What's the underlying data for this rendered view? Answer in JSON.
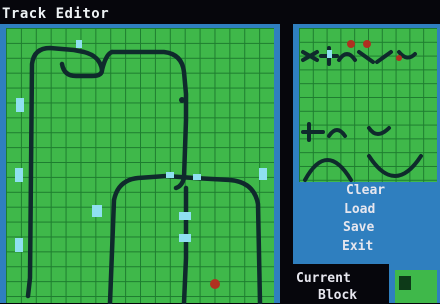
{
  "window": {
    "title": "Track Editor"
  },
  "menu": {
    "items": [
      {
        "id": "clear",
        "label": "Clear"
      },
      {
        "id": "load",
        "label": "Load"
      },
      {
        "id": "save",
        "label": "Save"
      },
      {
        "id": "exit",
        "label": "Exit"
      }
    ]
  },
  "current_block": {
    "label_line1": "Current",
    "label_line2": "Block"
  },
  "colors": {
    "grid_fill": "#3fb84a",
    "grid_lines": "#1e7d2f",
    "frame": "#2f7fbf",
    "track": "#0f2a2c",
    "track_joint": "#8fe0f0",
    "background": "#06060c"
  }
}
